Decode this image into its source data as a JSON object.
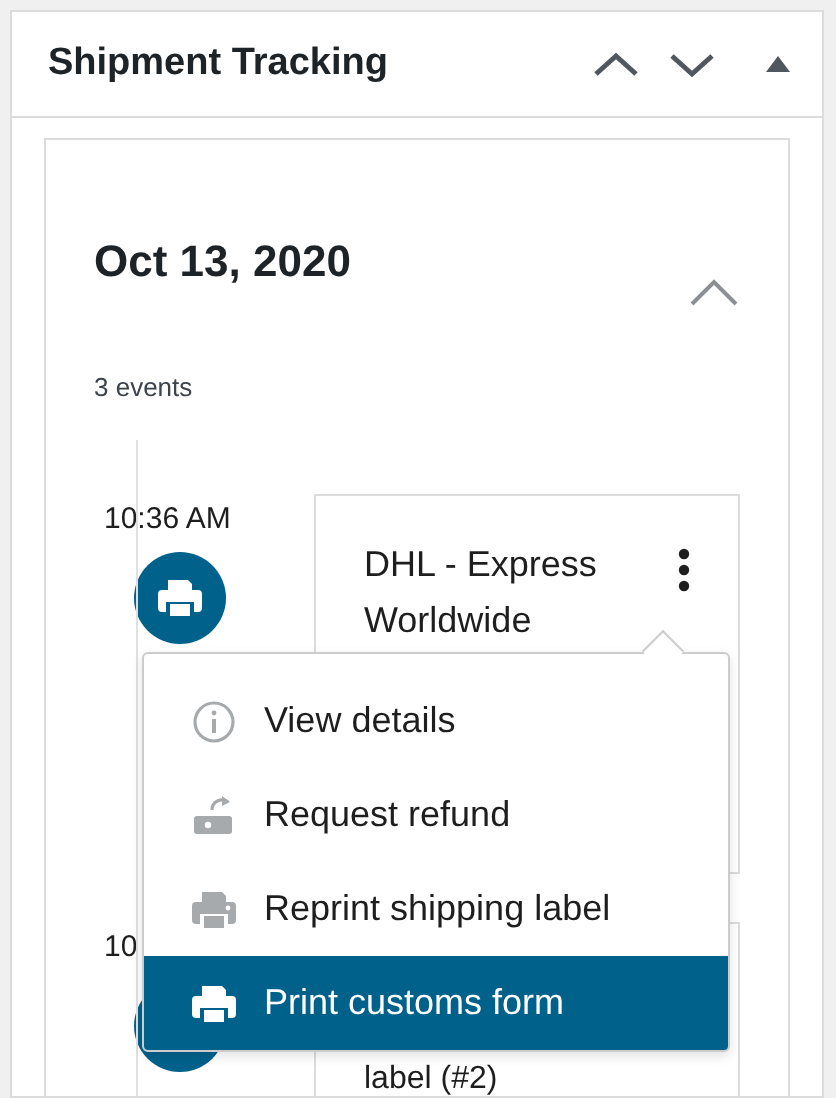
{
  "panel": {
    "title": "Shipment Tracking"
  },
  "day": {
    "date": "Oct 13, 2020",
    "expanded": true,
    "count": "3 events"
  },
  "events": [
    {
      "time": "10:36 AM",
      "text": "DHL - Express Worldwide"
    },
    {
      "time": "10",
      "text": "label (#2)"
    }
  ],
  "menu": {
    "items": [
      {
        "label": "View details",
        "kind": "info",
        "selected": false
      },
      {
        "label": "Request refund",
        "kind": "refund",
        "selected": false
      },
      {
        "label": "Reprint shipping label",
        "kind": "printer",
        "selected": false
      },
      {
        "label": "Print customs form",
        "kind": "printer",
        "selected": true
      }
    ]
  }
}
